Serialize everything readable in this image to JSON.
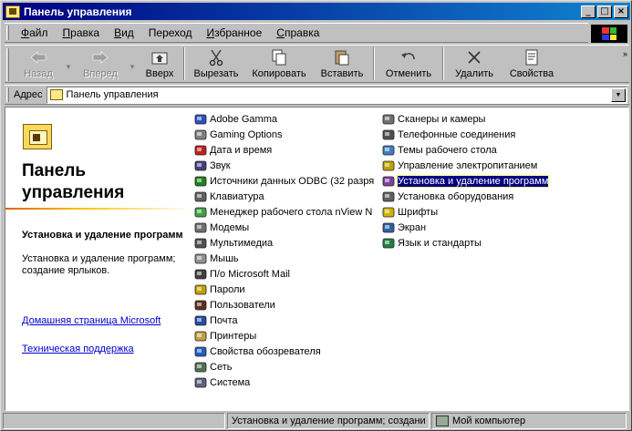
{
  "window": {
    "title": "Панель управления"
  },
  "titlebar_buttons": {
    "minimize": "_",
    "maximize": "□",
    "close": "×"
  },
  "menu": [
    {
      "label": "Файл",
      "key": "Ф",
      "rest": "айл"
    },
    {
      "label": "Правка",
      "key": "П",
      "rest": "равка"
    },
    {
      "label": "Вид",
      "key": "В",
      "rest": "ид"
    },
    {
      "label": "Переход",
      "key": "х",
      "pre": "Перех",
      "rest": "од"
    },
    {
      "label": "Избранное",
      "key": "И",
      "rest": "збранное"
    },
    {
      "label": "Справка",
      "key": "С",
      "rest": "правка"
    }
  ],
  "toolbar": {
    "back": "Назад",
    "forward": "Вперед",
    "up": "Вверх",
    "cut": "Вырезать",
    "copy": "Копировать",
    "paste": "Вставить",
    "undo": "Отменить",
    "delete": "Удалить",
    "properties": "Свойства"
  },
  "address": {
    "label": "Адрес",
    "label_key": "д",
    "value": "Панель управления"
  },
  "left_pane": {
    "title": "Панель управления",
    "desc_title": "Установка и удаление программ",
    "desc_text": "Установка и удаление программ; создание ярлыков.",
    "link_home": "Домашняя страница Microsoft",
    "link_support": "Техническая поддержка"
  },
  "items_col1": [
    {
      "label": "Adobe Gamma",
      "icon": "adobe-gamma-icon",
      "color": "#3050c0"
    },
    {
      "label": "Gaming Options",
      "icon": "gamepad-icon",
      "color": "#808080"
    },
    {
      "label": "Дата и время",
      "icon": "clock-icon",
      "color": "#c02020"
    },
    {
      "label": "Звук",
      "icon": "speaker-icon",
      "color": "#404080"
    },
    {
      "label": "Источники данных ODBC (32 разря",
      "icon": "database-icon",
      "color": "#208020"
    },
    {
      "label": "Клавиатура",
      "icon": "keyboard-icon",
      "color": "#606060"
    },
    {
      "label": "Менеджер рабочего стола nView N",
      "icon": "nview-icon",
      "color": "#40a040"
    },
    {
      "label": "Модемы",
      "icon": "modem-icon",
      "color": "#707070"
    },
    {
      "label": "Мультимедиа",
      "icon": "multimedia-icon",
      "color": "#505050"
    },
    {
      "label": "Мышь",
      "icon": "mouse-icon",
      "color": "#909090"
    },
    {
      "label": "П/о Microsoft Mail",
      "icon": "mail-icon",
      "color": "#404040"
    },
    {
      "label": "Пароли",
      "icon": "key-icon",
      "color": "#c0a000"
    },
    {
      "label": "Пользователи",
      "icon": "users-icon",
      "color": "#603020"
    },
    {
      "label": "Почта",
      "icon": "mailbox-icon",
      "color": "#2050a0"
    },
    {
      "label": "Принтеры",
      "icon": "printer-icon",
      "color": "#c0a040"
    },
    {
      "label": "Свойства обозревателя",
      "icon": "internet-options-icon",
      "color": "#2060c0"
    },
    {
      "label": "Сеть",
      "icon": "network-icon",
      "color": "#507050"
    },
    {
      "label": "Система",
      "icon": "system-icon",
      "color": "#606080"
    }
  ],
  "items_col2": [
    {
      "label": "Сканеры и камеры",
      "icon": "scanner-icon",
      "color": "#707070"
    },
    {
      "label": "Телефонные соединения",
      "icon": "phone-icon",
      "color": "#505050"
    },
    {
      "label": "Темы рабочего стола",
      "icon": "themes-icon",
      "color": "#4080c0"
    },
    {
      "label": "Управление электропитанием",
      "icon": "power-icon",
      "color": "#c0a000"
    },
    {
      "label": "Установка и удаление программ",
      "icon": "add-remove-icon",
      "color": "#8040a0",
      "selected": true
    },
    {
      "label": "Установка оборудования",
      "icon": "hardware-icon",
      "color": "#606060"
    },
    {
      "label": "Шрифты",
      "icon": "fonts-icon",
      "color": "#d0b000"
    },
    {
      "label": "Экран",
      "icon": "display-icon",
      "color": "#3060a0"
    },
    {
      "label": "Язык и стандарты",
      "icon": "globe-icon",
      "color": "#208040"
    }
  ],
  "status": {
    "text": "Установка и удаление программ; создани",
    "zone": "Мой компьютер"
  }
}
